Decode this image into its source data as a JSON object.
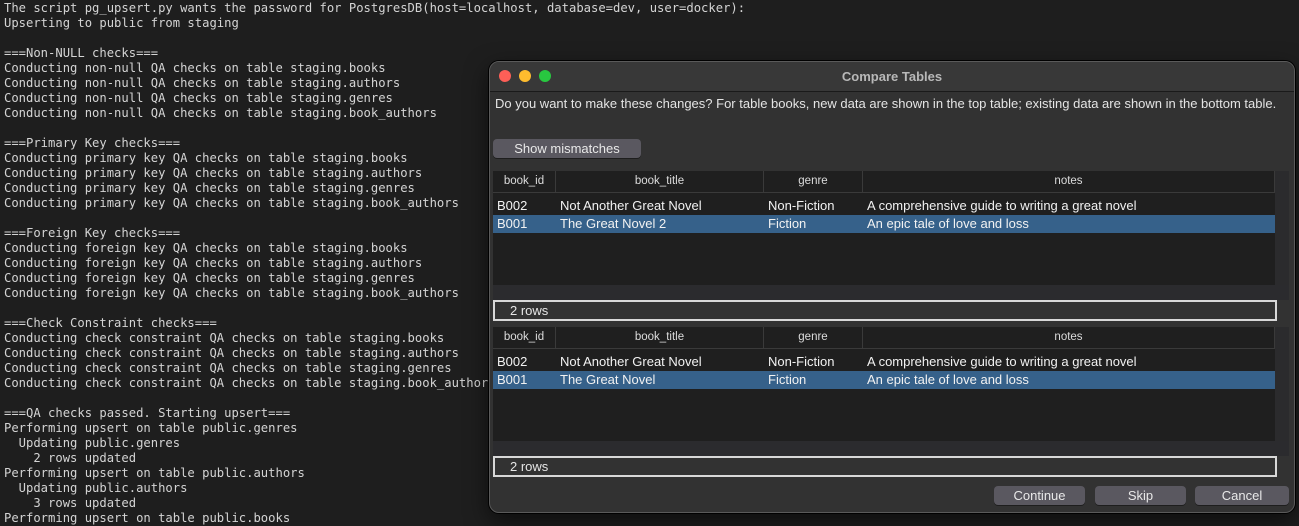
{
  "terminal": {
    "lines": [
      "The script pg_upsert.py wants the password for PostgresDB(host=localhost, database=dev, user=docker):",
      "Upserting to public from staging",
      "",
      "===Non-NULL checks===",
      "Conducting non-null QA checks on table staging.books",
      "Conducting non-null QA checks on table staging.authors",
      "Conducting non-null QA checks on table staging.genres",
      "Conducting non-null QA checks on table staging.book_authors",
      "",
      "===Primary Key checks===",
      "Conducting primary key QA checks on table staging.books",
      "Conducting primary key QA checks on table staging.authors",
      "Conducting primary key QA checks on table staging.genres",
      "Conducting primary key QA checks on table staging.book_authors",
      "",
      "===Foreign Key checks===",
      "Conducting foreign key QA checks on table staging.books",
      "Conducting foreign key QA checks on table staging.authors",
      "Conducting foreign key QA checks on table staging.genres",
      "Conducting foreign key QA checks on table staging.book_authors",
      "",
      "===Check Constraint checks===",
      "Conducting check constraint QA checks on table staging.books",
      "Conducting check constraint QA checks on table staging.authors",
      "Conducting check constraint QA checks on table staging.genres",
      "Conducting check constraint QA checks on table staging.book_authors",
      "",
      "===QA checks passed. Starting upsert===",
      "Performing upsert on table public.genres",
      "  Updating public.genres",
      "    2 rows updated",
      "Performing upsert on table public.authors",
      "  Updating public.authors",
      "    3 rows updated",
      "Performing upsert on table public.books"
    ]
  },
  "dialog": {
    "title": "Compare Tables",
    "prompt": "Do you want to make these changes? For table books, new data are shown in the top table; existing data are shown in the bottom table.",
    "show_mismatches_label": "Show mismatches",
    "columns": [
      "book_id",
      "book_title",
      "genre",
      "notes"
    ],
    "new_table": {
      "rows": [
        [
          "B002",
          "Not Another Great Novel",
          "Non-Fiction",
          "A comprehensive guide to writing a great novel"
        ],
        [
          "B001",
          "The Great Novel 2",
          "Fiction",
          "An epic tale of love and loss"
        ]
      ],
      "selected_row": 1,
      "row_count": "2 rows"
    },
    "existing_table": {
      "rows": [
        [
          "B002",
          "Not Another Great Novel",
          "Non-Fiction",
          "A comprehensive guide to writing a great novel"
        ],
        [
          "B001",
          "The Great Novel",
          "Fiction",
          "An epic tale of love and loss"
        ]
      ],
      "selected_row": 1,
      "row_count": "2 rows"
    },
    "buttons": {
      "continue": "Continue",
      "skip": "Skip",
      "cancel": "Cancel"
    }
  },
  "colors": {
    "selection": "#36618a",
    "close": "#fe5f57",
    "minimize": "#febc2e",
    "maximize": "#28c840"
  }
}
